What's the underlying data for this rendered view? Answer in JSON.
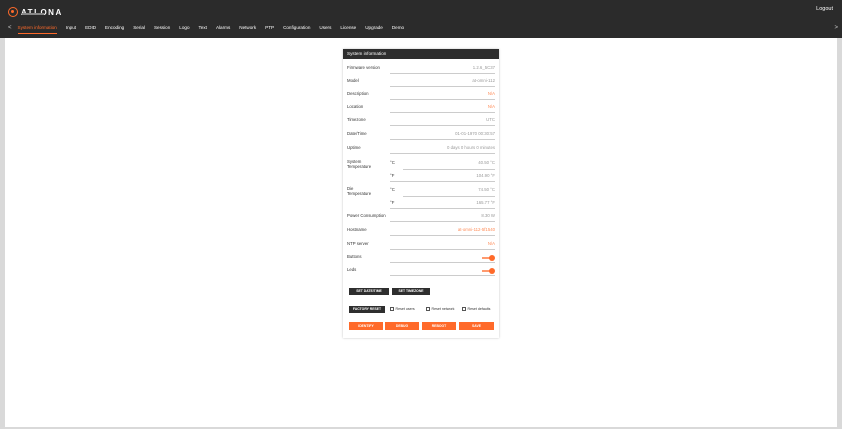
{
  "app": {
    "logo_text": "ATLONA",
    "logout": "Logout"
  },
  "nav": {
    "left_arrow": "<",
    "right_arrow": ">",
    "tabs": [
      "System information",
      "Input",
      "EDID",
      "Encoding",
      "Serial",
      "Session",
      "Logo",
      "Text",
      "Alarms",
      "Network",
      "PTP",
      "Configuration",
      "Users",
      "License",
      "Upgrade",
      "Demo"
    ],
    "active_tab": "System information"
  },
  "panel": {
    "title": "System information",
    "firmware_label": "Firmware version",
    "firmware_value": "1.2.6_5C37",
    "model_label": "Model",
    "model_value": "at-omni-112",
    "description_label": "Description",
    "description_value": "N/A",
    "location_label": "Location",
    "location_value": "N/A",
    "timezone_label": "Timezone",
    "timezone_value": "UTC",
    "datetime_label": "Date/Time",
    "datetime_value": "01-01-1970 00:30:57",
    "uptime_label": "Uptime",
    "uptime_value": "0 days 0 hours 0 minutes",
    "sys_temp_label_1": "System",
    "sys_temp_label_2": "Temperature",
    "sys_temp_c_unit": "°C",
    "sys_temp_c_value": "40.50 °C",
    "sys_temp_f_unit": "°F",
    "sys_temp_f_value": "104.90 °F",
    "die_temp_label_1": "Die",
    "die_temp_label_2": "Temperature",
    "die_temp_c_unit": "°C",
    "die_temp_c_value": "74.50 °C",
    "die_temp_f_unit": "°F",
    "die_temp_f_value": "165.77 °F",
    "power_label": "Power Consumption",
    "power_value": "8.30 W",
    "hostname_label": "Hostname",
    "hostname_value": "at-omni-112-5f1540",
    "ntp_label": "NTP server",
    "ntp_value": "N/A",
    "buttons_label": "Buttons",
    "buttons_on": true,
    "leds_label": "Leds",
    "leds_on": true,
    "set_datetime": "SET DATE/TIME",
    "set_timezone": "SET TIMEZONE",
    "factory_reset": "FACTORY RESET",
    "reset_users": "Reset users",
    "reset_network": "Reset network",
    "reset_defaults": "Reset defaults",
    "identify": "IDENTIFY",
    "debug": "DEBUG",
    "reboot": "REBOOT",
    "save": "SAVE"
  },
  "colors": {
    "accent": "#ff6a2a",
    "header_bg": "#2b2b2b",
    "page_bg": "#d9d9d9"
  }
}
